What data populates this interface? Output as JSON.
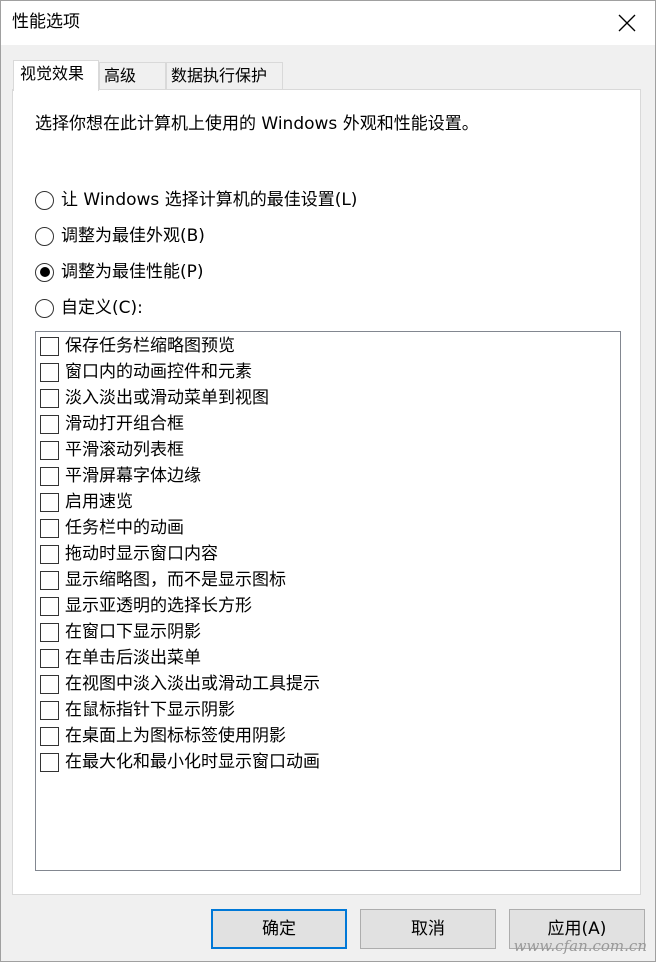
{
  "window": {
    "title": "性能选项"
  },
  "tabs": [
    {
      "label": "视觉效果",
      "active": true
    },
    {
      "label": "高级",
      "active": false
    },
    {
      "label": "数据执行保护",
      "active": false
    }
  ],
  "panel": {
    "intro": "选择你想在此计算机上使用的 Windows 外观和性能设置。",
    "radios": [
      {
        "label": "让 Windows 选择计算机的最佳设置(L)",
        "checked": false
      },
      {
        "label": "调整为最佳外观(B)",
        "checked": false
      },
      {
        "label": "调整为最佳性能(P)",
        "checked": true
      },
      {
        "label": "自定义(C):",
        "checked": false
      }
    ],
    "options": [
      {
        "label": "保存任务栏缩略图预览",
        "checked": false
      },
      {
        "label": "窗口内的动画控件和元素",
        "checked": false
      },
      {
        "label": "淡入淡出或滑动菜单到视图",
        "checked": false
      },
      {
        "label": "滑动打开组合框",
        "checked": false
      },
      {
        "label": "平滑滚动列表框",
        "checked": false
      },
      {
        "label": "平滑屏幕字体边缘",
        "checked": false
      },
      {
        "label": "启用速览",
        "checked": false
      },
      {
        "label": "任务栏中的动画",
        "checked": false
      },
      {
        "label": "拖动时显示窗口内容",
        "checked": false
      },
      {
        "label": "显示缩略图，而不是显示图标",
        "checked": false
      },
      {
        "label": "显示亚透明的选择长方形",
        "checked": false
      },
      {
        "label": "在窗口下显示阴影",
        "checked": false
      },
      {
        "label": "在单击后淡出菜单",
        "checked": false
      },
      {
        "label": "在视图中淡入淡出或滑动工具提示",
        "checked": false
      },
      {
        "label": "在鼠标指针下显示阴影",
        "checked": false
      },
      {
        "label": "在桌面上为图标标签使用阴影",
        "checked": false
      },
      {
        "label": "在最大化和最小化时显示窗口动画",
        "checked": false
      }
    ]
  },
  "buttons": {
    "ok": "确定",
    "cancel": "取消",
    "apply": "应用(A)"
  },
  "watermark": "www.cfan.com.cn",
  "colors": {
    "accent": "#0078d7",
    "dialog_bg": "#f0f0f0",
    "panel_bg": "#ffffff"
  }
}
